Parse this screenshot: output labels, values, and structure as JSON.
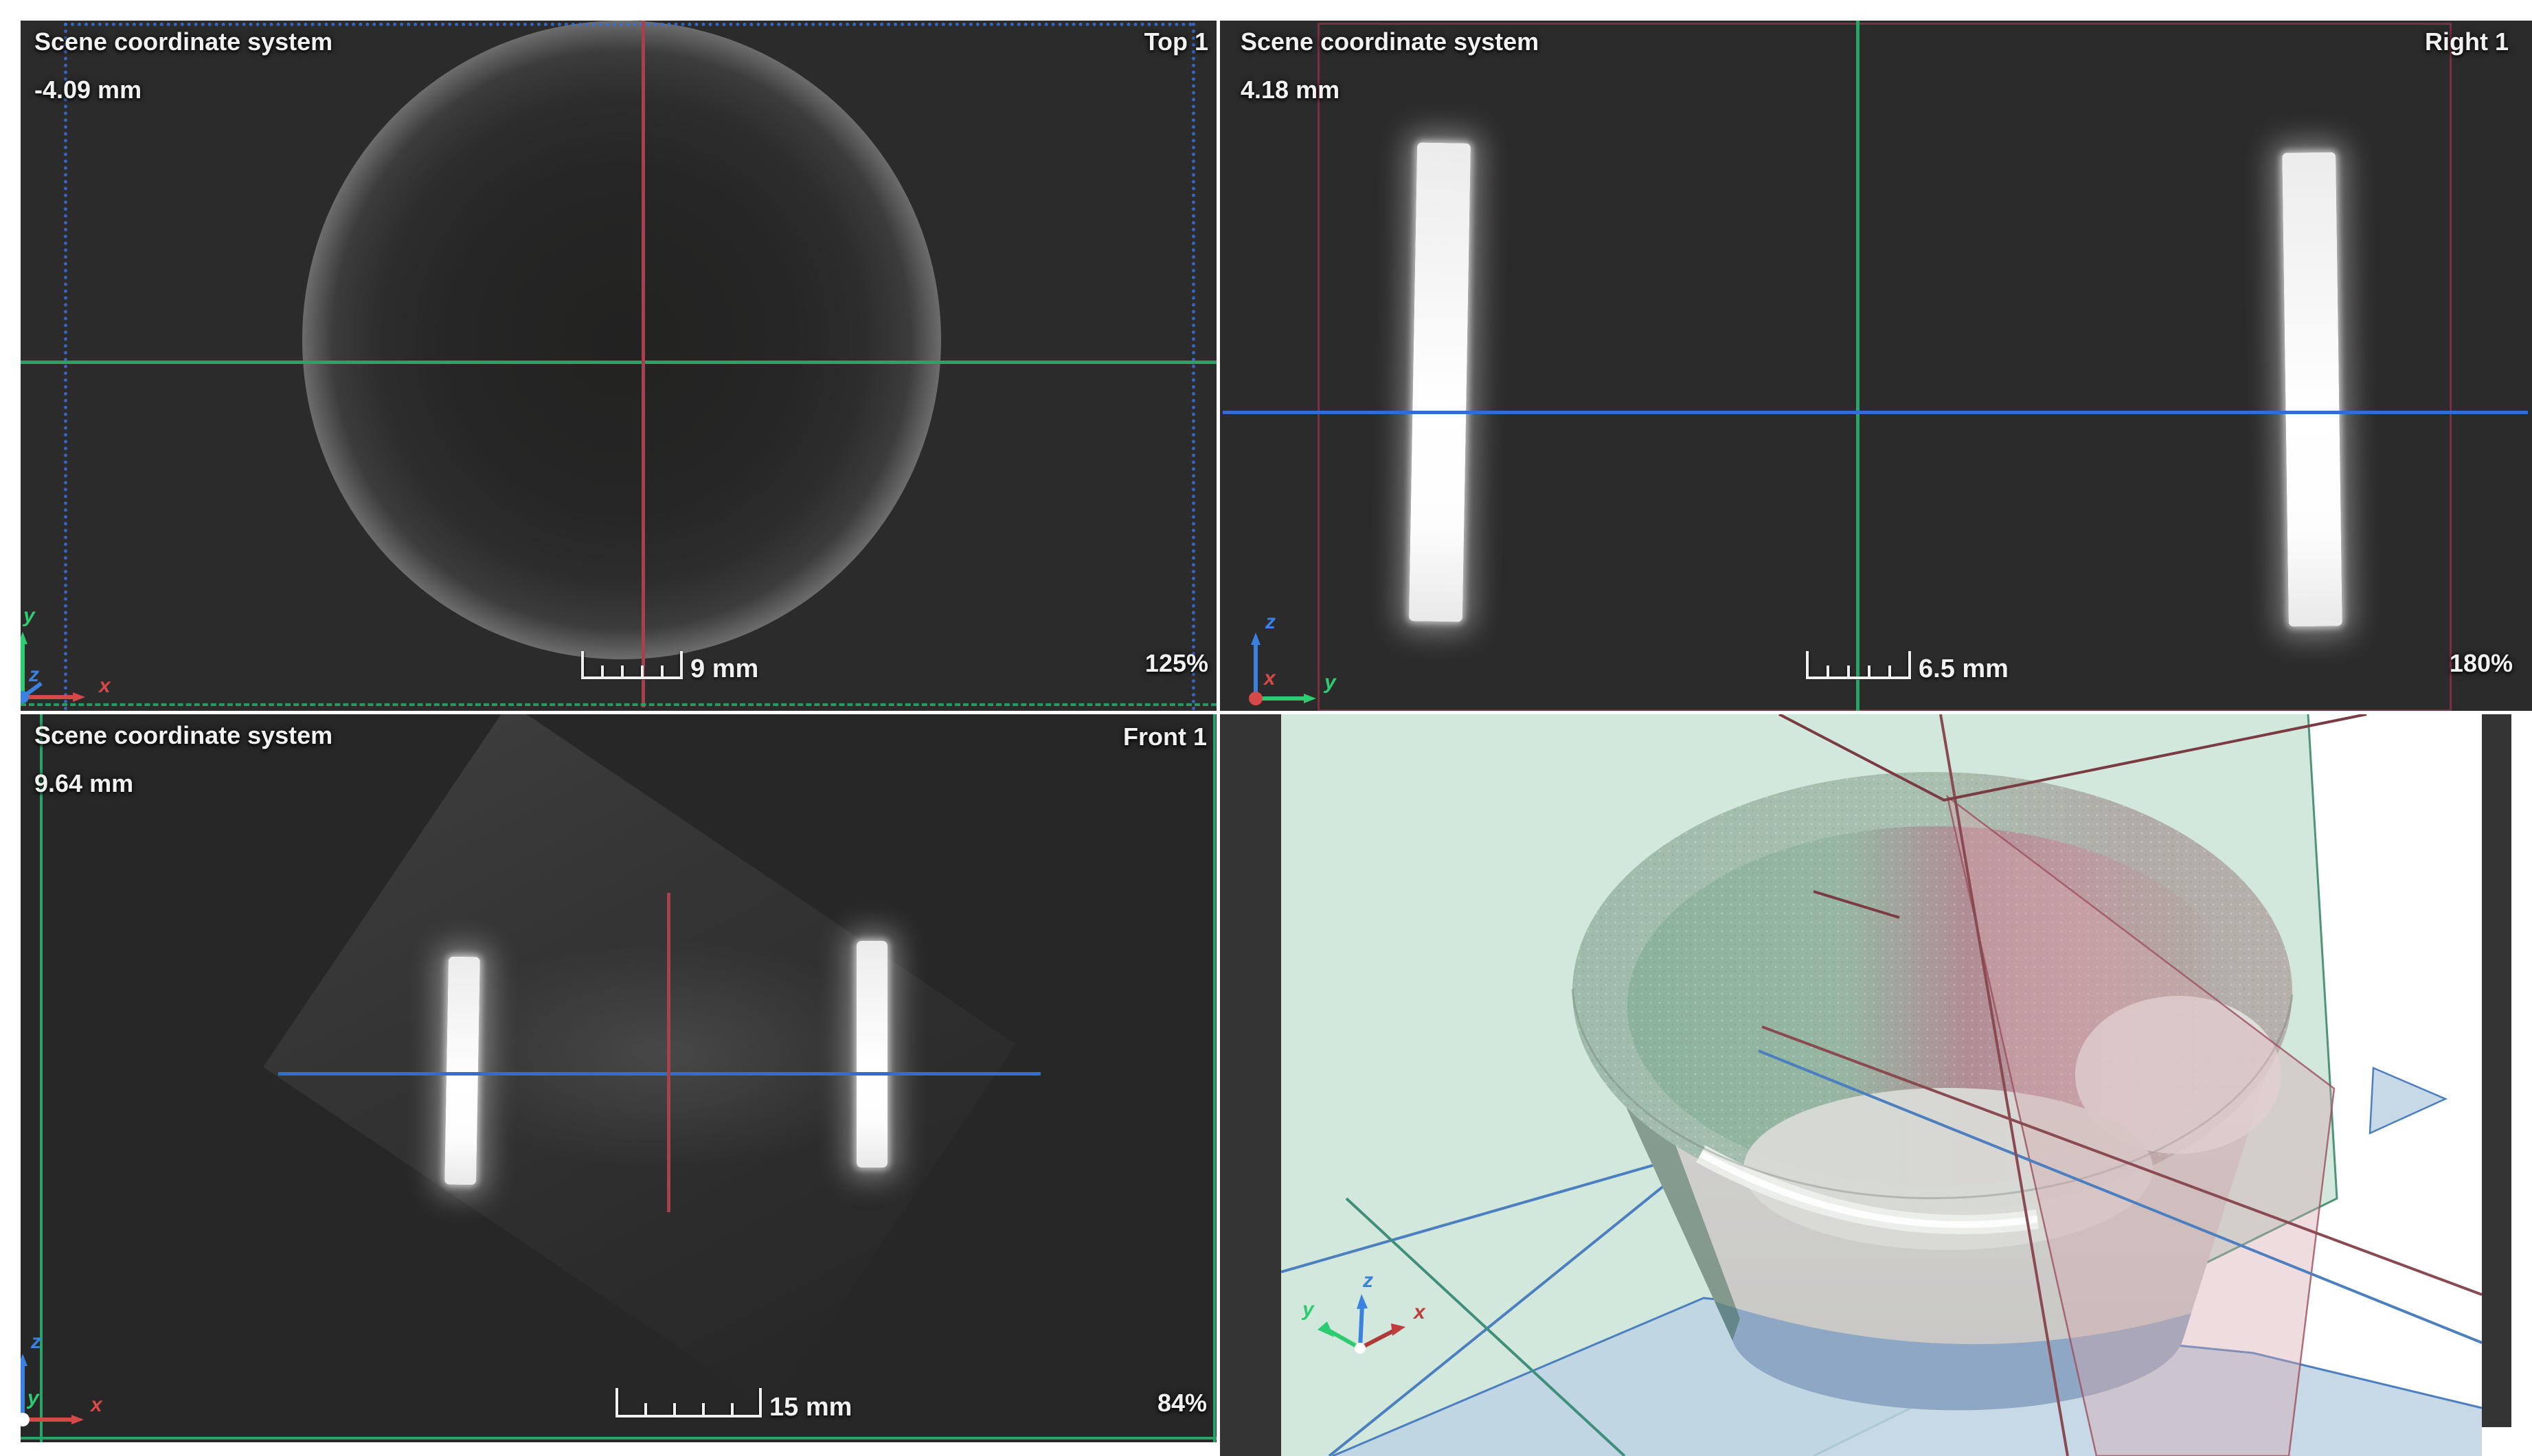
{
  "window": {
    "background": "#ffffff"
  },
  "colors": {
    "viewport_bg": "#2c2b2b",
    "viewport_bg_front": "#272727",
    "text": "#f1f1f1",
    "crosshair_green": "#27a567",
    "crosshair_red": "#a8414e",
    "crosshair_blue": "#2e6fd0",
    "bbox_blue": "#3a6fd8",
    "bbox_red": "#7c2f3c",
    "axis_x": "#d64949",
    "axis_y": "#2ecc71",
    "axis_z": "#3b82e0",
    "plane_green_fill": "#cfe6d9",
    "plane_green_edge": "#4e9478",
    "plane_blue_fill": "#bdd2e3",
    "plane_blue_edge": "#4b7fc0",
    "plane_red_fill": "#d4a7ad",
    "plane_red_edge": "#9c4f5c",
    "strip_dark": "#333333"
  },
  "viewports": {
    "top": {
      "coordinate_system": "Scene coordinate system",
      "slice_position": "-4.09 mm",
      "view_label": "Top 1",
      "scale_label": "9 mm",
      "zoom_level": "125%",
      "axis_up": "y",
      "axis_right": "x",
      "axis_out": "z"
    },
    "right": {
      "coordinate_system": "Scene coordinate system",
      "slice_position": "4.18 mm",
      "view_label": "Right 1",
      "scale_label": "6.5 mm",
      "zoom_level": "180%",
      "axis_up": "z",
      "axis_right": "y",
      "axis_out": "x"
    },
    "front": {
      "coordinate_system": "Scene coordinate system",
      "slice_position": "9.64 mm",
      "view_label": "Front 1",
      "scale_label": "15 mm",
      "zoom_level": "84%",
      "axis_up": "z",
      "axis_right": "x",
      "axis_out": "y"
    },
    "scene3d": {
      "axis_x": "x",
      "axis_y": "y",
      "axis_z": "z"
    }
  }
}
